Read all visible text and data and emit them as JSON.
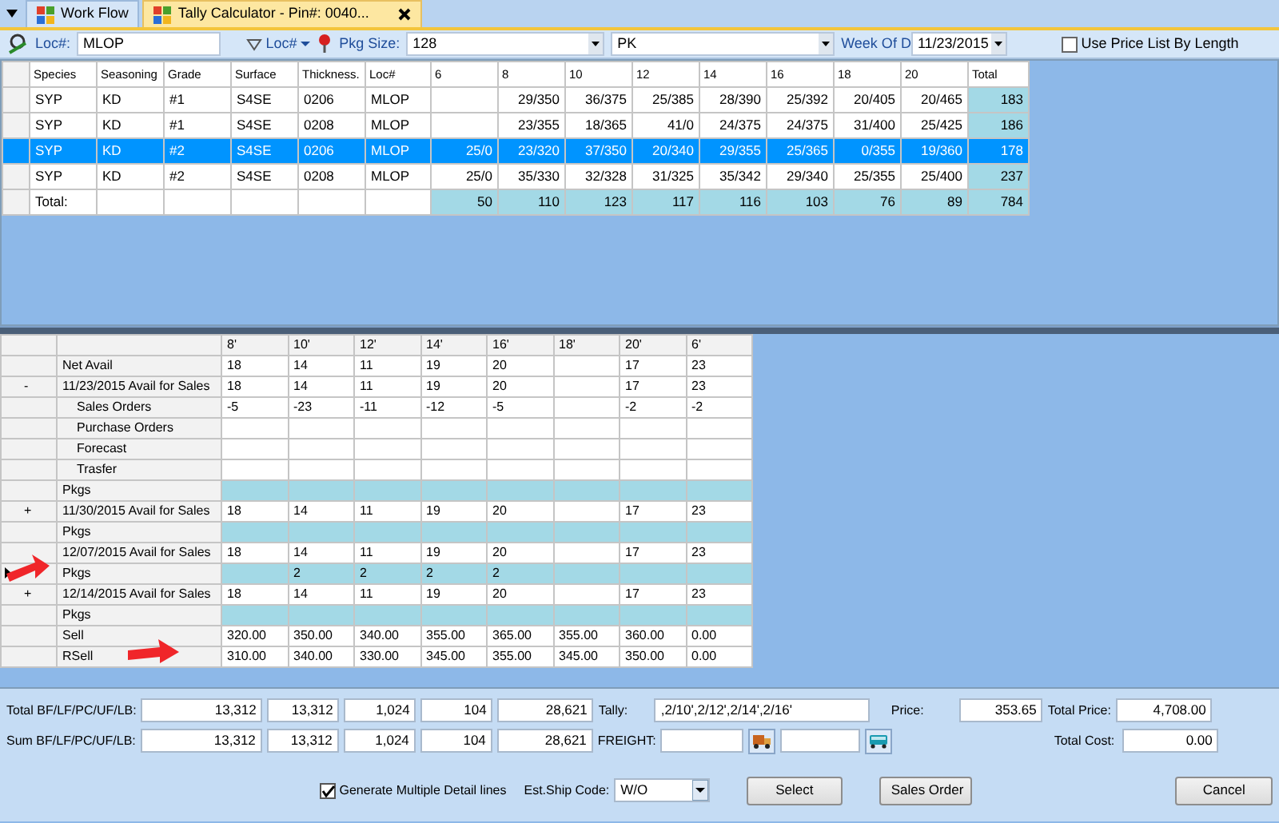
{
  "tabs": [
    {
      "label": "Work Flow",
      "selected": false
    },
    {
      "label": "Tally Calculator - Pin#: 0040...",
      "selected": true
    }
  ],
  "toolbar": {
    "loc_label": "Loc#:",
    "loc_value": "MLOP",
    "loc_dropdown": "Loc#",
    "pkg_label": "Pkg Size:",
    "pkg_size": "128",
    "unit": "PK",
    "week_label": "Week Of D",
    "week_value": "11/23/2015",
    "price_list": {
      "label": "Use Price List By Length",
      "checked": false
    }
  },
  "top_grid": {
    "columns": [
      "Species",
      "Seasoning",
      "Grade",
      "Surface",
      "Thickness.",
      "Loc#",
      "6",
      "8",
      "10",
      "12",
      "14",
      "16",
      "18",
      "20",
      "Total"
    ],
    "rows": [
      {
        "selected": false,
        "cells": [
          "SYP",
          "KD",
          "#1",
          "S4SE",
          "0206",
          "MLOP",
          null,
          "29/350",
          "36/375",
          "25/385",
          "28/390",
          "25/392",
          "20/405",
          "20/465",
          "183"
        ]
      },
      {
        "selected": false,
        "cells": [
          "SYP",
          "KD",
          "#1",
          "S4SE",
          "0208",
          "MLOP",
          null,
          "23/355",
          "18/365",
          "41/0",
          "24/375",
          "24/375",
          "31/400",
          "25/425",
          "186"
        ]
      },
      {
        "selected": true,
        "cells": [
          "SYP",
          "KD",
          "#2",
          "S4SE",
          "0206",
          "MLOP",
          "25/0",
          "23/320",
          "37/350",
          "20/340",
          "29/355",
          "25/365",
          "0/355",
          "19/360",
          "178"
        ]
      },
      {
        "selected": false,
        "cells": [
          "SYP",
          "KD",
          "#2",
          "S4SE",
          "0208",
          "MLOP",
          "25/0",
          "35/330",
          "32/328",
          "31/325",
          "35/342",
          "29/340",
          "25/355",
          "25/400",
          "237"
        ]
      }
    ],
    "total": {
      "label": "Total:",
      "values": [
        "50",
        "110",
        "123",
        "117",
        "116",
        "103",
        "76",
        "89",
        "784"
      ]
    }
  },
  "lower_grid": {
    "columns": [
      "8'",
      "10'",
      "12'",
      "14'",
      "16'",
      "18'",
      "20'",
      "6'"
    ],
    "rows": [
      {
        "label": "Net Avail",
        "kind": "data",
        "cells": [
          "18",
          "14",
          "11",
          "19",
          "20",
          null,
          "17",
          "23"
        ]
      },
      {
        "label": "11/23/2015 Avail for Sales",
        "expander": "-",
        "kind": "data",
        "cells": [
          "18",
          "14",
          "11",
          "19",
          "20",
          null,
          "17",
          "23"
        ],
        "children": [
          {
            "label": "Sales Orders",
            "kind": "data",
            "cells": [
              "-5",
              "-23",
              "-11",
              "-12",
              "-5",
              null,
              "-2",
              "-2"
            ]
          },
          {
            "label": "Purchase Orders",
            "kind": "data",
            "cells": [
              null,
              null,
              null,
              null,
              null,
              null,
              null,
              null
            ]
          },
          {
            "label": "Forecast",
            "kind": "data",
            "cells": [
              null,
              null,
              null,
              null,
              null,
              null,
              null,
              null
            ]
          },
          {
            "label": "Trasfer",
            "kind": "data",
            "cells": [
              null,
              null,
              null,
              null,
              null,
              null,
              null,
              null
            ]
          }
        ]
      },
      {
        "label": "Pkgs",
        "kind": "pkgs",
        "cells": [
          null,
          null,
          null,
          null,
          null,
          null,
          null,
          null
        ]
      },
      {
        "label": "11/30/2015 Avail for Sales",
        "expander": "+",
        "kind": "data",
        "cells": [
          "18",
          "14",
          "11",
          "19",
          "20",
          null,
          "17",
          "23"
        ]
      },
      {
        "label": "Pkgs",
        "kind": "pkgs",
        "cells": [
          null,
          null,
          null,
          null,
          null,
          null,
          null,
          null
        ]
      },
      {
        "label": "12/07/2015 Avail for Sales",
        "kind": "data",
        "cells": [
          "18",
          "14",
          "11",
          "19",
          "20",
          null,
          "17",
          "23"
        ]
      },
      {
        "label": "Pkgs",
        "kind": "pkgs",
        "current": true,
        "cells": [
          null,
          "2",
          "2",
          "2",
          "2",
          null,
          null,
          null
        ]
      },
      {
        "label": "12/14/2015 Avail for Sales",
        "expander": "+",
        "kind": "data",
        "cells": [
          "18",
          "14",
          "11",
          "19",
          "20",
          null,
          "17",
          "23"
        ]
      },
      {
        "label": "Pkgs",
        "kind": "pkgs",
        "cells": [
          null,
          null,
          null,
          null,
          null,
          null,
          null,
          null
        ]
      },
      {
        "label": "Sell",
        "kind": "data",
        "cells": [
          "320.00",
          "350.00",
          "340.00",
          "355.00",
          "365.00",
          "355.00",
          "360.00",
          "0.00"
        ]
      },
      {
        "label": "RSell",
        "kind": "data",
        "cells": [
          "310.00",
          "340.00",
          "330.00",
          "345.00",
          "355.00",
          "345.00",
          "350.00",
          "0.00"
        ]
      }
    ]
  },
  "summary": {
    "rows": [
      {
        "label": "Total BF/LF/PC/UF/LB:",
        "values": [
          "13,312",
          "13,312",
          "1,024",
          "104",
          "28,621"
        ]
      },
      {
        "label": "Sum BF/LF/PC/UF/LB:",
        "values": [
          "13,312",
          "13,312",
          "1,024",
          "104",
          "28,621"
        ]
      }
    ],
    "tally_label": "Tally:",
    "tally_value": ",2/10',2/12',2/14',2/16'",
    "freight_label": "FREIGHT:",
    "price_label": "Price:",
    "price_value": "353.65",
    "total_price_label": "Total Price:",
    "total_price_value": "4,708.00",
    "total_cost_label": "Total Cost:",
    "total_cost_value": "0.00"
  },
  "footer": {
    "multi_lines": {
      "label": "Generate Multiple Detail lines",
      "checked": true
    },
    "ship_code_label": "Est.Ship Code:",
    "ship_code_value": "W/O",
    "buttons": [
      "Select",
      "Sales Order",
      "Cancel"
    ]
  }
}
